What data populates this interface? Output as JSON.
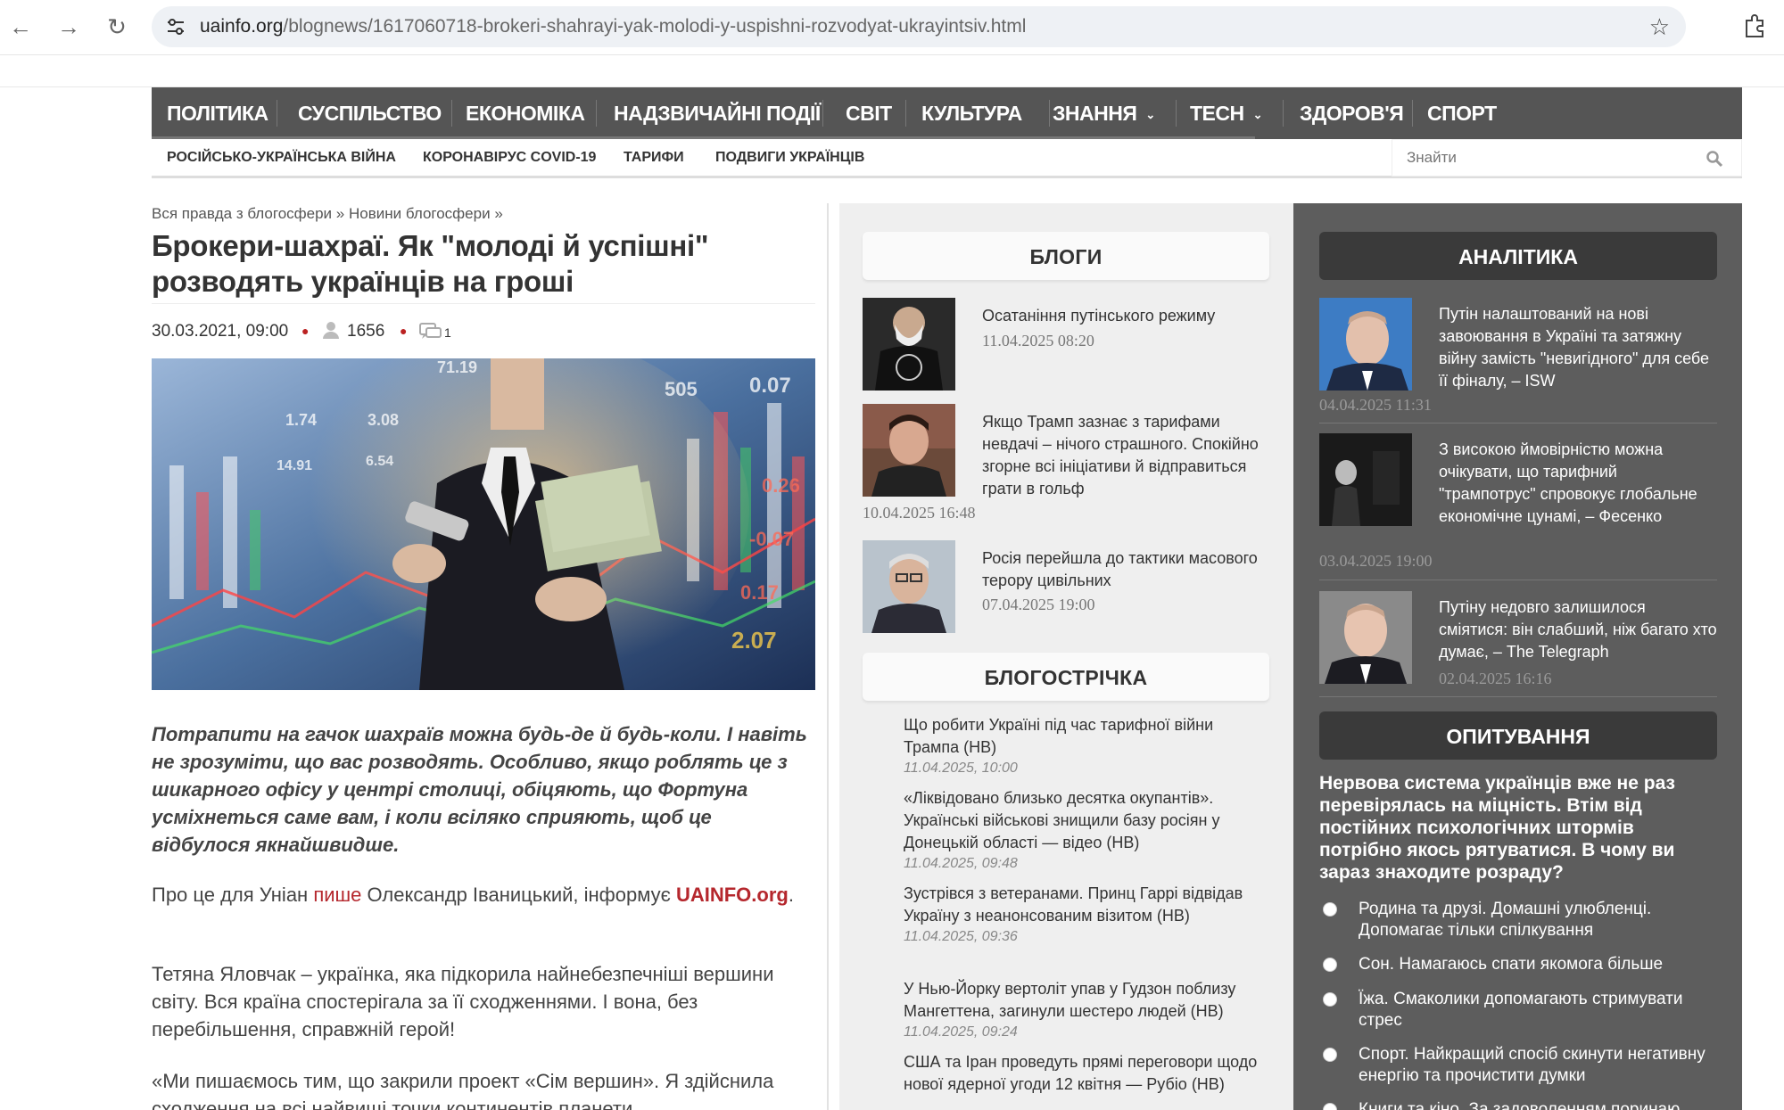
{
  "browser": {
    "url_host": "uainfo.org",
    "url_path": "/blognews/1617060718-brokeri-shahrayi-yak-molodi-y-uspishni-rozvodyat-ukrayintsiv.html"
  },
  "mainnav": {
    "items": [
      "ПОЛІТИКА",
      "СУСПІЛЬСТВО",
      "ЕКОНОМІКА",
      "НАДЗВИЧАЙНІ ПОДІЇ",
      "СВІТ",
      "КУЛЬТУРА",
      "ЗНАННЯ",
      "TECH",
      "ЗДОРОВ'Я",
      "СПОРТ"
    ]
  },
  "subnav": {
    "items": [
      "РОСІЙСЬКО-УКРАЇНСЬКА ВІЙНА",
      "КОРОНАВІРУС COVID-19",
      "ТАРИФИ",
      "ПОДВИГИ УКРАЇНЦІВ"
    ],
    "search_placeholder": "Знайти"
  },
  "article": {
    "breadcrumb": [
      "Вся правда з блогосфери",
      "Новини блогосфери"
    ],
    "breadcrumb_sep": "»",
    "title": "Брокери-шахраї. Як \"молоді й успішні\" розводять українців на гроші",
    "date": "30.03.2021, 09:00",
    "views": "1656",
    "comments": "1",
    "lead": "Потрапити на гачок шахраїв можна будь-де й будь-коли. І навіть не зрозуміти, що вас розводять. Особливо, якщо роблять це з шикарного офісу у центрі столиці, обіцяють, що Фортуна усміхнеться саме вам, і коли всіляко сприяють, щоб це відбулося якнайшвидше.",
    "p1_a": "Про це для Уніан ",
    "p1_link": "пише",
    "p1_b": " Олександр Іваницький, інформує ",
    "p1_site": "UAINFO.org",
    "p1_end": ".",
    "p2": "Тетяна Яловчак – українка, яка підкорила найнебезпечніші вершини світу. Вся країна спостерігала за її сходженнями. І вона, без перебільшення, справжній герой!",
    "p3": "«Ми пишаємось тим, що закрили проект «Сім вершин». Я здійснила сходження на всі найвищі точки континентів планети"
  },
  "hero_numbers": [
    "71.19",
    "505",
    "0.07",
    "1.74",
    "3.08",
    "6.54",
    "14.91",
    "0.26",
    "-0.07",
    "0.17",
    "2.07"
  ],
  "blogs": {
    "heading": "БЛОГИ",
    "items": [
      {
        "title": "Осатаніння путінського режиму",
        "date": "11.04.2025 08:20"
      },
      {
        "title": "Якщо Трамп зазнає з тарифами невдачі – нічого страшного. Спокійно згорне всі ініціативи й відправиться грати в гольф",
        "date": "10.04.2025 16:48"
      },
      {
        "title": "Росія перейшла до тактики масового терору цивільних",
        "date": "07.04.2025 19:00"
      }
    ]
  },
  "stream": {
    "heading": "БЛОГОСТРІЧКА",
    "items": [
      {
        "title": "Що робити Україні під час тарифної війни Трампа (НВ)",
        "date": "11.04.2025, 10:00"
      },
      {
        "title": "«Ліквідовано близько десятка окупантів». Українські військові знищили базу росіян у Донецькій області — відео (НВ)",
        "date": "11.04.2025, 09:48"
      },
      {
        "title": "Зустрівся з ветеранами. Принц Гаррі відвідав Україну з неанонсованим візитом (НВ)",
        "date": "11.04.2025, 09:36"
      },
      {
        "title": "У Нью-Йорку вертоліт упав у Гудзон поблизу Мангеттена, загинули шестеро людей (НВ)",
        "date": "11.04.2025, 09:24"
      },
      {
        "title": "США та Іран проведуть прямі переговори щодо нової ядерної угоди 12 квітня — Рубіо (НВ)",
        "date": ""
      }
    ]
  },
  "analytics": {
    "heading": "АНАЛІТИКА",
    "items": [
      {
        "title": "Путін налаштований на нові завоювання в Україні та затяжну війну замість \"невигідного\" для себе її фіналу, – ISW",
        "date": "04.04.2025 11:31"
      },
      {
        "title": "З високою ймовірністю можна очікувати, що тарифний \"трампотрус\" спровокує глобальне економічне цунамі, – Фесенко",
        "date": "03.04.2025 19:00"
      },
      {
        "title": "Путіну недовго залишилося сміятися: він слабший, ніж багато хто думає, – The Telegraph",
        "date": "02.04.2025 16:16"
      }
    ]
  },
  "poll": {
    "heading": "ОПИТУВАННЯ",
    "question": "Нервова система українців вже не раз перевірялась на міцність. Втім від постійних психологічних штормів потрібно якось рятуватися. В чому ви зараз знаходите розраду?",
    "options": [
      "Родина та друзі. Домашні улюбленці. Допомагає тільки спілкування",
      "Сон. Намагаюсь спати якомога більше",
      "Їжа. Смаколики допомагають стримувати стрес",
      "Спорт. Найкращий спосіб скинути негативну енергію та прочистити думки",
      "Книги та кіно. За задоволенням поринаю"
    ]
  },
  "colors": {
    "nav_bg": "#555555",
    "right_bg": "#5d5d5d",
    "mid_bg": "#efefef",
    "link_red": "#b5272d"
  }
}
